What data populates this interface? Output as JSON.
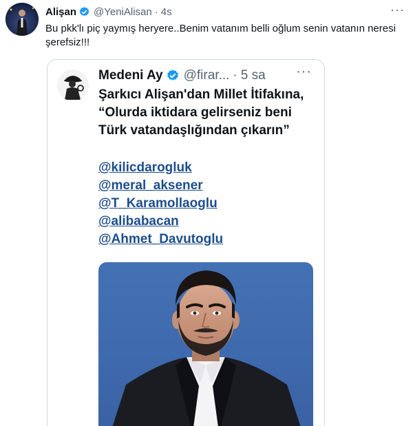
{
  "tweet": {
    "display_name": "Alişan",
    "handle": "@YeniAlisan",
    "separator": "·",
    "time": "4s",
    "more_label": "···",
    "text": "Bu pkk'lı piç yaymış heryere..Benim vatanım belli oğlum senin vatanın neresi şerefsiz!!!"
  },
  "quoted": {
    "display_name": "Medeni Ay",
    "handle": "@firar...",
    "separator": "·",
    "time": "5 sa",
    "more_label": "···",
    "text": "Şarkıcı Alişan'dan Millet İtifakına, “Olurda iktidara gelirseniz beni Türk vatandaşlığından çıkarın”",
    "mentions": [
      "@kilicdarogluk",
      "@meral_aksener",
      "@T_Karamollaoglu",
      "@alibabacan",
      "@Ahmet_Davutoglu"
    ]
  },
  "colors": {
    "verified": "#1d9bf0",
    "link": "#1d4e8c",
    "photo_bg": "#4471b4",
    "muted": "#536471"
  },
  "icons": {
    "verified": "verified-badge-icon",
    "more": "more-horizontal-icon"
  }
}
